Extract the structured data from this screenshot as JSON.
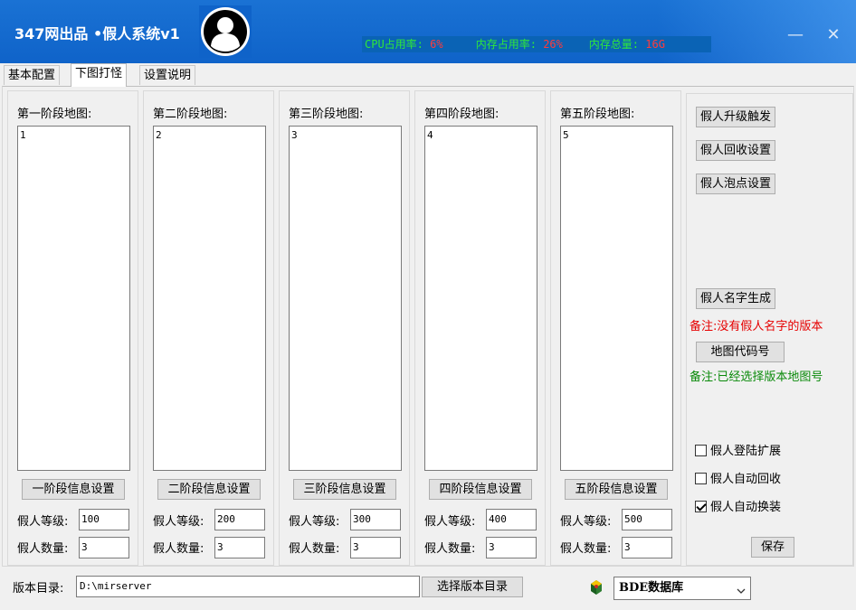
{
  "window": {
    "title": "347网出品 •假人系统v1",
    "minimize_symbol": "—",
    "close_symbol": "✕"
  },
  "stats": {
    "cpu_label": "CPU占用率:",
    "cpu_value": "6%",
    "mem_label": "内存占用率:",
    "mem_value": "26%",
    "total_label": "内存总量:",
    "total_value": "16G"
  },
  "tabs": [
    {
      "label": "基本配置"
    },
    {
      "label": "下图打怪"
    },
    {
      "label": "设置说明"
    }
  ],
  "stages": [
    {
      "title": "第一阶段地图:",
      "memo": "1",
      "button": "一阶段信息设置",
      "level_label": "假人等级:",
      "level": "100",
      "count_label": "假人数量:",
      "count": "3"
    },
    {
      "title": "第二阶段地图:",
      "memo": "2",
      "button": "二阶段信息设置",
      "level_label": "假人等级:",
      "level": "200",
      "count_label": "假人数量:",
      "count": "3"
    },
    {
      "title": "第三阶段地图:",
      "memo": "3",
      "button": "三阶段信息设置",
      "level_label": "假人等级:",
      "level": "300",
      "count_label": "假人数量:",
      "count": "3"
    },
    {
      "title": "第四阶段地图:",
      "memo": "4",
      "button": "四阶段信息设置",
      "level_label": "假人等级:",
      "level": "400",
      "count_label": "假人数量:",
      "count": "3"
    },
    {
      "title": "第五阶段地图:",
      "memo": "5",
      "button": "五阶段信息设置",
      "level_label": "假人等级:",
      "level": "500",
      "count_label": "假人数量:",
      "count": "3"
    }
  ],
  "side": {
    "upgrade_trigger": "假人升级触发",
    "recycle_settings": "假人回收设置",
    "afk_settings": "假人泡点设置",
    "name_generate": "假人名字生成",
    "note_red": "备注:没有假人名字的版本",
    "map_code": "地图代码号",
    "note_green": "备注:已经选择版本地图号",
    "chk_login_ext": "假人登陆扩展",
    "chk_auto_recycle": "假人自动回收",
    "chk_auto_equip": "假人自动换装",
    "chk_login_ext_checked": false,
    "chk_auto_recycle_checked": false,
    "chk_auto_equip_checked": true,
    "save": "保存"
  },
  "bottom": {
    "dir_label": "版本目录:",
    "dir_value": "D:\\mirserver",
    "dir_button": "选择版本目录",
    "db_value": "BDE数据库"
  },
  "colors": {
    "titlebar": "#1a72d4",
    "stat_label": "#2ee83a",
    "stat_value": "#ff3b3b",
    "note_red": "#e60000",
    "note_green": "#0a8a0a"
  }
}
